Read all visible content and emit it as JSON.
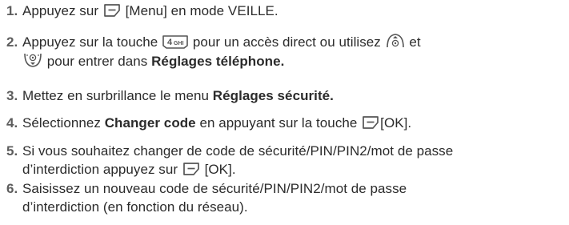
{
  "steps": [
    {
      "number": "1.",
      "text_a": "Appuyez sur",
      "text_b": "[Menu] en mode VEILLE."
    },
    {
      "number": "2.",
      "text_a": "Appuyez sur la touche",
      "text_b": "pour un accès direct ou utilisez",
      "text_c": "et",
      "text_d": "pour entrer dans",
      "bold_a": "Réglages téléphone."
    },
    {
      "number": "3.",
      "text_a": "Mettez en surbrillance le menu",
      "bold_a": "Réglages sécurité."
    },
    {
      "number": "4.",
      "text_a": "Sélectionnez",
      "bold_a": "Changer code",
      "text_b": "en appuyant sur la touche",
      "text_c": "[OK]."
    },
    {
      "number": "5.",
      "text_a": "Si vous souhaitez changer de code de sécurité/PIN/PIN2/mot de passe",
      "text_b": "d’interdiction appuyez sur",
      "text_c": "[OK]."
    },
    {
      "number": "6.",
      "text_a": "Saisissez un nouveau code de sécurité/PIN/PIN2/mot de passe",
      "text_b": "d’interdiction (en fonction du réseau)."
    }
  ],
  "icons": {
    "soft_key": "soft-key-icon",
    "key_4": "key-4-ghi-icon",
    "nav_up": "nav-key-up-icon",
    "nav_down": "nav-key-down-icon"
  },
  "key_4_label": "4",
  "key_4_sub": "GHI",
  "colors": {
    "text": "#2b2b2b",
    "number": "#5d5d5d",
    "icon_stroke": "#555555"
  }
}
